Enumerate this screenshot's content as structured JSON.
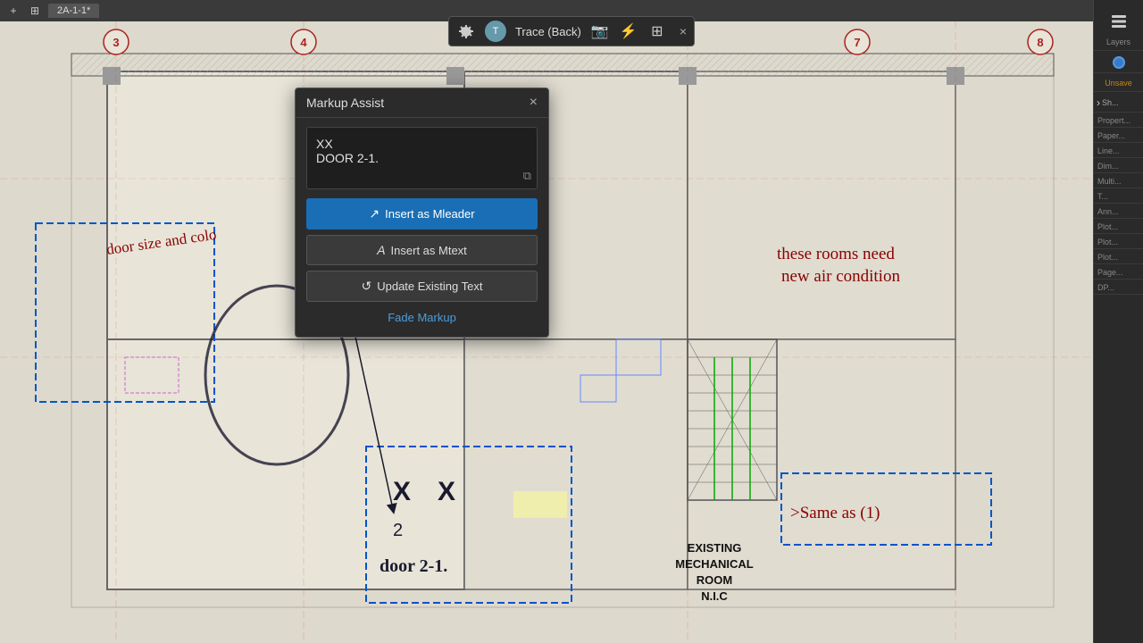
{
  "app": {
    "tab_label": "2A-1-1*",
    "title": "Markup Assist"
  },
  "trace_toolbar": {
    "label": "Trace (Back)",
    "close_label": "×"
  },
  "dialog": {
    "title": "Markup Assist",
    "close_label": "×",
    "recognized_text_line1": "XX",
    "recognized_text_line2": "DOOR 2-1.",
    "btn_insert_mleader": "Insert as Mleader",
    "btn_insert_mtext": "Insert as Mtext",
    "btn_update_text": "Update Existing Text",
    "btn_fade": "Fade Markup"
  },
  "right_panel": {
    "layers_label": "Layers",
    "unsaved_label": "Unsave",
    "properties_label": "Propert...",
    "paper_label": "Paper...",
    "line_label": "Line...",
    "dim_label": "Dim...",
    "multi_label": "Multi...",
    "t_label": "T...",
    "ann_label": "Ann...",
    "plot1_label": "Plot...",
    "plot2_label": "Plot...",
    "plot3_label": "Plot...",
    "page_label": "Page...",
    "dp_label": "DP..."
  },
  "blueprint": {
    "col_markers": [
      "3",
      "4",
      "7",
      "8"
    ],
    "room_label": "EXISTING\nMECHANICAL\nROOM\nN.I.C",
    "handwriting1": "door size and color",
    "handwriting2": "these rooms need\nnew air condition",
    "handwriting3": "door 2-1.",
    "handwriting4": ">Same as (1)"
  },
  "icons": {
    "settings": "⚙",
    "camera": "📷",
    "lightning": "⚡",
    "grid": "⊞",
    "close": "×",
    "mleader": "↗",
    "mtext": "A",
    "update": "↺",
    "copy": "⧉",
    "layers_icon": "≡",
    "chevron_right": "›",
    "dot": "●"
  }
}
